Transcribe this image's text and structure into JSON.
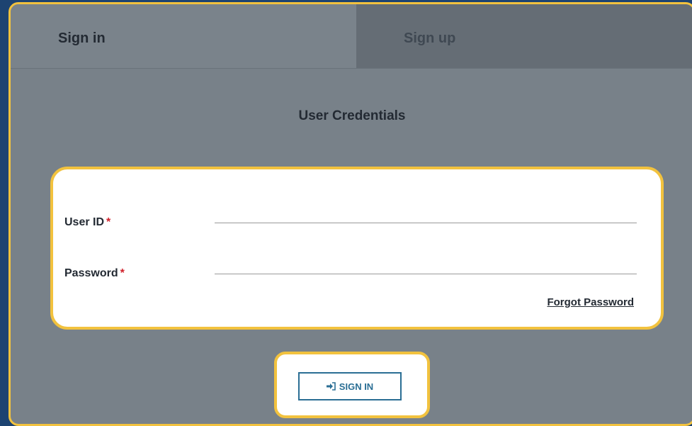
{
  "tabs": {
    "signin_label": "Sign in",
    "signup_label": "Sign up",
    "active": "signin"
  },
  "form": {
    "section_title": "User Credentials",
    "user_id_label": "User ID",
    "password_label": "Password",
    "required_marker": "*",
    "forgot_password_label": "Forgot Password",
    "submit_label": "SIGN IN",
    "submit_icon": "sign-in-arrow-icon"
  },
  "colors": {
    "background": "#1d4371",
    "panel": "#788189",
    "highlight_border": "#f2c23e",
    "button_accent": "#2a6e94",
    "required": "#d0202a"
  }
}
